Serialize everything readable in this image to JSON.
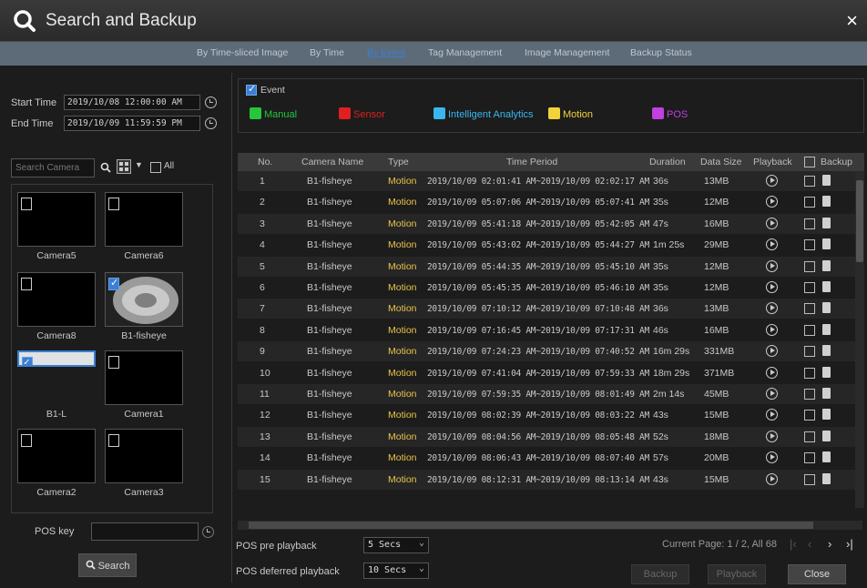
{
  "window": {
    "title": "Search and Backup",
    "close_label": "×"
  },
  "tabs": [
    {
      "label": "By Time-sliced Image",
      "active": false
    },
    {
      "label": "By Time",
      "active": false
    },
    {
      "label": "By Event",
      "active": true
    },
    {
      "label": "Tag Management",
      "active": false
    },
    {
      "label": "Image Management",
      "active": false
    },
    {
      "label": "Backup Status",
      "active": false
    }
  ],
  "filters": {
    "start_label": "Start Time",
    "start_value": "2019/10/08 12:00:00 AM",
    "end_label": "End Time",
    "end_value": "2019/10/09 11:59:59 PM",
    "search_camera_placeholder": "Search Camera",
    "all_label": "All"
  },
  "cameras": [
    {
      "name": "Camera5",
      "checked": false
    },
    {
      "name": "Camera6",
      "checked": false
    },
    {
      "name": "Camera8",
      "checked": false
    },
    {
      "name": "B1-fisheye",
      "checked": true
    },
    {
      "name": "B1-L",
      "checked": true
    },
    {
      "name": "Camera1",
      "checked": false
    },
    {
      "name": "Camera2",
      "checked": false
    },
    {
      "name": "Camera3",
      "checked": false
    }
  ],
  "pos": {
    "key_label": "POS key",
    "key_value": ""
  },
  "search_button": "Search",
  "event": {
    "label": "Event",
    "types": [
      {
        "label": "Manual",
        "color": "#26c53a"
      },
      {
        "label": "Sensor",
        "color": "#e02020"
      },
      {
        "label": "Intelligent Analytics",
        "color": "#39b8f0"
      },
      {
        "label": "Motion",
        "color": "#f2d23a"
      },
      {
        "label": "POS",
        "color": "#c040e0"
      }
    ]
  },
  "table": {
    "headers": {
      "no": "No.",
      "camera": "Camera Name",
      "type": "Type",
      "time": "Time Period",
      "duration": "Duration",
      "size": "Data Size",
      "playback": "Playback",
      "backup": "Backup"
    },
    "rows": [
      {
        "no": "1",
        "camera": "B1-fisheye",
        "type": "Motion",
        "time": "2019/10/09 02:01:41 AM~2019/10/09 02:02:17 AM",
        "duration": "36s",
        "size": "13MB"
      },
      {
        "no": "2",
        "camera": "B1-fisheye",
        "type": "Motion",
        "time": "2019/10/09 05:07:06 AM~2019/10/09 05:07:41 AM",
        "duration": "35s",
        "size": "12MB"
      },
      {
        "no": "3",
        "camera": "B1-fisheye",
        "type": "Motion",
        "time": "2019/10/09 05:41:18 AM~2019/10/09 05:42:05 AM",
        "duration": "47s",
        "size": "16MB"
      },
      {
        "no": "4",
        "camera": "B1-fisheye",
        "type": "Motion",
        "time": "2019/10/09 05:43:02 AM~2019/10/09 05:44:27 AM",
        "duration": "1m 25s",
        "size": "29MB"
      },
      {
        "no": "5",
        "camera": "B1-fisheye",
        "type": "Motion",
        "time": "2019/10/09 05:44:35 AM~2019/10/09 05:45:10 AM",
        "duration": "35s",
        "size": "12MB"
      },
      {
        "no": "6",
        "camera": "B1-fisheye",
        "type": "Motion",
        "time": "2019/10/09 05:45:35 AM~2019/10/09 05:46:10 AM",
        "duration": "35s",
        "size": "12MB"
      },
      {
        "no": "7",
        "camera": "B1-fisheye",
        "type": "Motion",
        "time": "2019/10/09 07:10:12 AM~2019/10/09 07:10:48 AM",
        "duration": "36s",
        "size": "13MB"
      },
      {
        "no": "8",
        "camera": "B1-fisheye",
        "type": "Motion",
        "time": "2019/10/09 07:16:45 AM~2019/10/09 07:17:31 AM",
        "duration": "46s",
        "size": "16MB"
      },
      {
        "no": "9",
        "camera": "B1-fisheye",
        "type": "Motion",
        "time": "2019/10/09 07:24:23 AM~2019/10/09 07:40:52 AM",
        "duration": "16m 29s",
        "size": "331MB"
      },
      {
        "no": "10",
        "camera": "B1-fisheye",
        "type": "Motion",
        "time": "2019/10/09 07:41:04 AM~2019/10/09 07:59:33 AM",
        "duration": "18m 29s",
        "size": "371MB"
      },
      {
        "no": "11",
        "camera": "B1-fisheye",
        "type": "Motion",
        "time": "2019/10/09 07:59:35 AM~2019/10/09 08:01:49 AM",
        "duration": "2m 14s",
        "size": "45MB"
      },
      {
        "no": "12",
        "camera": "B1-fisheye",
        "type": "Motion",
        "time": "2019/10/09 08:02:39 AM~2019/10/09 08:03:22 AM",
        "duration": "43s",
        "size": "15MB"
      },
      {
        "no": "13",
        "camera": "B1-fisheye",
        "type": "Motion",
        "time": "2019/10/09 08:04:56 AM~2019/10/09 08:05:48 AM",
        "duration": "52s",
        "size": "18MB"
      },
      {
        "no": "14",
        "camera": "B1-fisheye",
        "type": "Motion",
        "time": "2019/10/09 08:06:43 AM~2019/10/09 08:07:40 AM",
        "duration": "57s",
        "size": "20MB"
      },
      {
        "no": "15",
        "camera": "B1-fisheye",
        "type": "Motion",
        "time": "2019/10/09 08:12:31 AM~2019/10/09 08:13:14 AM",
        "duration": "43s",
        "size": "15MB"
      }
    ]
  },
  "footer": {
    "pre_playback_label": "POS pre playback",
    "pre_playback_value": "5 Secs",
    "deferred_label": "POS deferred playback",
    "deferred_value": "10 Secs",
    "page_info": "Current Page: 1 / 2, All 68",
    "backup_button": "Backup",
    "playback_button": "Playback",
    "close_button": "Close"
  },
  "colors": {
    "accent": "#3b7fd1",
    "motion_text": "#e8c54a",
    "tabbar": "#5d6b78"
  }
}
